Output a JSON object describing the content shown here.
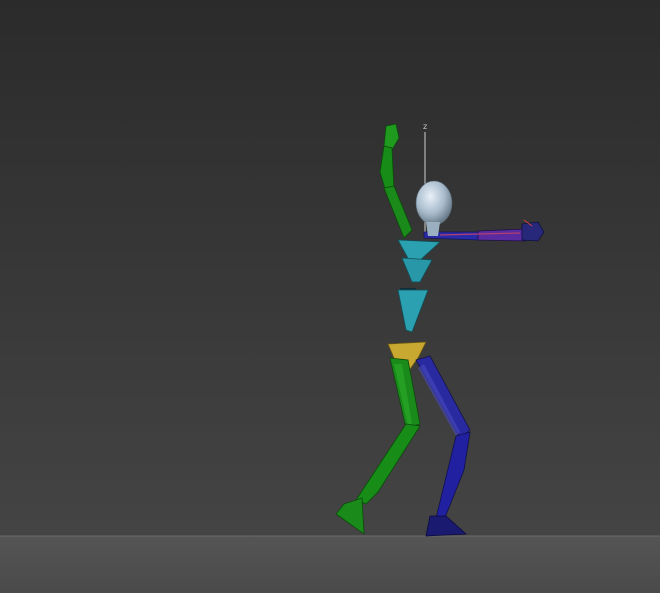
{
  "viewport": {
    "axis_label": "z",
    "colors": {
      "background_top": "#2b2b2b",
      "background_bottom": "#4a4a4a",
      "ground": "#5a5a5a",
      "left_limbs": "#1a8a1a",
      "right_limbs": "#2a2aa8",
      "spine": "#2aa0b0",
      "pelvis": "#c8a830",
      "head": "#b8c8d8",
      "right_arm_highlight": "#8030a0"
    }
  }
}
